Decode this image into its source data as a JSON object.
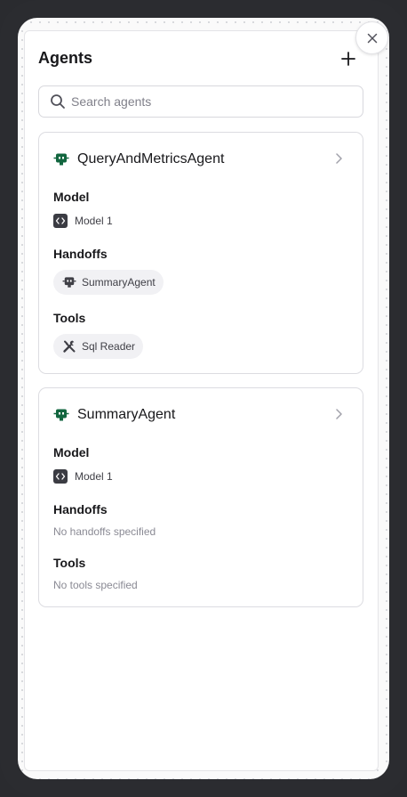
{
  "header": {
    "title": "Agents"
  },
  "search": {
    "placeholder": "Search agents"
  },
  "agents": [
    {
      "name": "QueryAndMetricsAgent",
      "model_label": "Model",
      "model": "Model 1",
      "handoffs_label": "Handoffs",
      "handoffs": [
        "SummaryAgent"
      ],
      "tools_label": "Tools",
      "tools": [
        "Sql Reader"
      ]
    },
    {
      "name": "SummaryAgent",
      "model_label": "Model",
      "model": "Model 1",
      "handoffs_label": "Handoffs",
      "handoffs_empty": "No handoffs specified",
      "tools_label": "Tools",
      "tools_empty": "No tools specified"
    }
  ],
  "icons": {
    "agent": "bot-icon",
    "model": "code-icon",
    "tool": "wrench-screwdriver-icon",
    "add": "plus-icon",
    "close": "close-icon",
    "chevron": "chevron-right-icon",
    "search": "search-icon"
  },
  "colors": {
    "agent_icon": "#12663f",
    "model_icon_bg": "#3b3c43"
  }
}
